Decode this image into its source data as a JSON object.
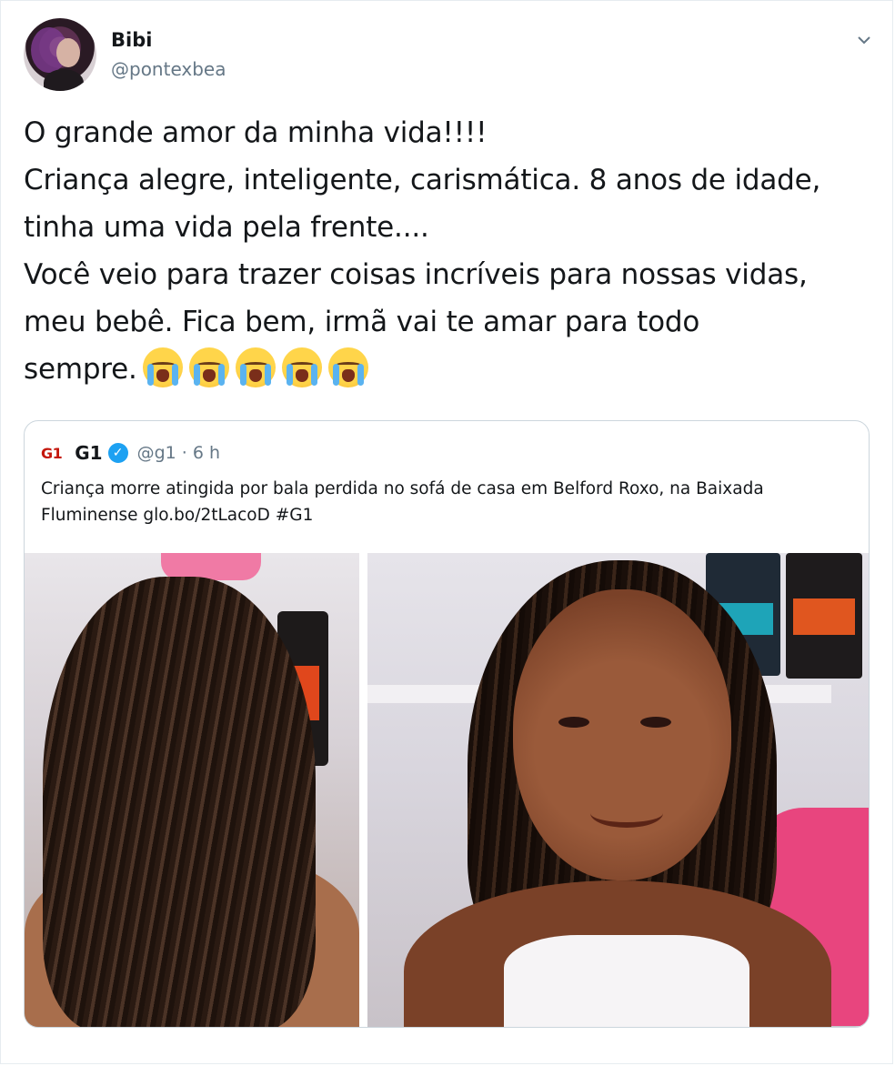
{
  "tweet": {
    "author_name": "Bibi",
    "author_handle": "@pontexbea",
    "text": "O grande amor da minha vida!!!!\nCriança alegre, inteligente, carismática. 8 anos de idade,\ntinha uma vida pela frente....\nVocê veio para trazer coisas incríveis para nossas vidas,\nmeu bebê. Fica bem, irmã vai te amar para todo\nsempre.",
    "emojis": [
      "loudly-crying-face",
      "loudly-crying-face",
      "loudly-crying-face",
      "loudly-crying-face",
      "loudly-crying-face"
    ],
    "menu_icon": "chevron-down-icon"
  },
  "quoted_tweet": {
    "logo_text": "G1",
    "name": "G1",
    "verified_icon": "verified-badge-icon",
    "handle_time": "@g1 · 6 h",
    "text": "Criança morre atingida por bala perdida no sofá de casa em Belford Roxo, na Baixada Fluminense glo.bo/2tLacoD #G1",
    "images": [
      "photo-back-of-girl-curly-hair",
      "photo-smiling-girl-curly-hair"
    ]
  },
  "colors": {
    "text": "#14171a",
    "secondary_text": "#657786",
    "border": "#ccd6dd",
    "verified": "#1da1f2",
    "g1_red": "#c4170c"
  }
}
